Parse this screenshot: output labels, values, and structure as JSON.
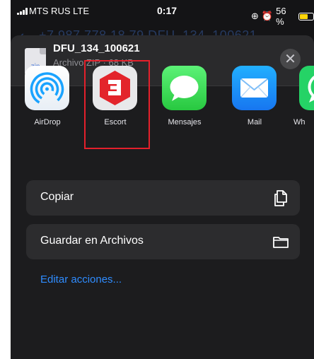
{
  "status_bar": {
    "carrier": "MTS RUS  LTE",
    "time": "0:17",
    "battery": "56 %",
    "battery_level": 0.56
  },
  "behind_header": {
    "text": "+7 987 778 18 79 DFU_134_100621"
  },
  "file": {
    "name": "DFU_134_100621",
    "meta": "Archivo ZIP · 68 KB",
    "ext": "zip"
  },
  "apps": [
    {
      "label": "AirDrop"
    },
    {
      "label": "Escort"
    },
    {
      "label": "Mensajes"
    },
    {
      "label": "Mail"
    },
    {
      "label": "Wh"
    }
  ],
  "actions": [
    {
      "label": "Copiar",
      "icon": "copy-icon"
    },
    {
      "label": "Guardar en Archivos",
      "icon": "folder-icon"
    }
  ],
  "edit_actions": "Editar acciones...",
  "colors": {
    "sheet_bg": "#1c1c1e",
    "row_bg": "#2c2c2e",
    "accent_link": "#2f8cff",
    "highlight": "#e4202b",
    "escort_brand": "#e3242b"
  }
}
